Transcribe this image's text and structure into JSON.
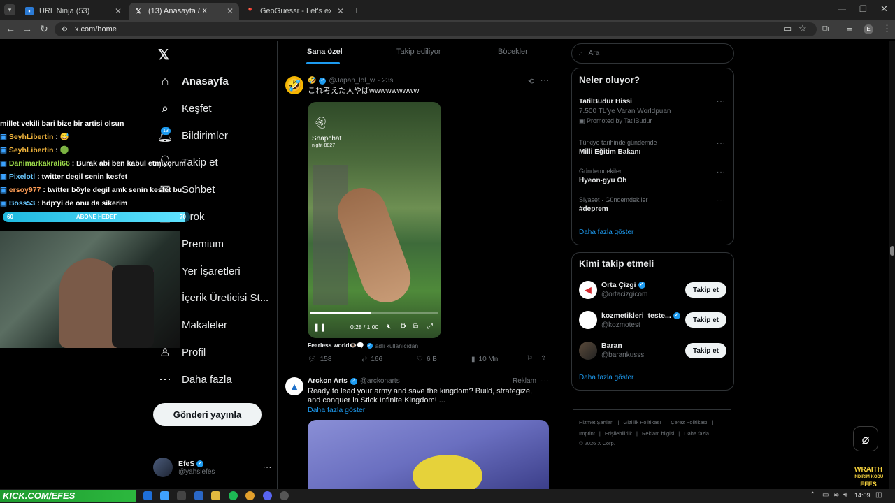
{
  "browser": {
    "tabs": [
      {
        "title": "URL Ninja (53)"
      },
      {
        "title": "(13) Anasayfa / X"
      },
      {
        "title": "GeoGuessr - Let's explore the w"
      }
    ],
    "url": "x.com/home",
    "profile_initial": "E"
  },
  "sidebar": {
    "logo": "𝕏",
    "notif_badge": "13",
    "items": [
      {
        "label": "Anasayfa",
        "icon": "home-icon"
      },
      {
        "label": "Keşfet",
        "icon": "search-icon"
      },
      {
        "label": "Bildirimler",
        "icon": "bell-icon"
      },
      {
        "label": "Takip et",
        "icon": "follow-icon"
      },
      {
        "label": "Sohbet",
        "icon": "chat-icon"
      },
      {
        "label": "Grok",
        "icon": "grok-icon"
      },
      {
        "label": "Premium",
        "icon": "x-premium-icon"
      },
      {
        "label": "Yer İşaretleri",
        "icon": "bookmark-icon"
      },
      {
        "label": "İçerik Üreticisi St...",
        "icon": "creator-studio-icon"
      },
      {
        "label": "Makaleler",
        "icon": "articles-icon"
      },
      {
        "label": "Profil",
        "icon": "profile-icon"
      },
      {
        "label": "Daha fazla",
        "icon": "more-icon"
      }
    ],
    "post_button": "Gönderi yayınla",
    "account": {
      "name": "EfeS",
      "handle": "@yahslefes"
    }
  },
  "overlay": {
    "chat": [
      {
        "user": "",
        "color": "#ffffff",
        "msg": "millet vekili bari bize bir artisi olsun"
      },
      {
        "user": "SeyhLibertin",
        "color": "#f6b83d",
        "msg": ": 😅"
      },
      {
        "user": "SeyhLibertin",
        "color": "#f6b83d",
        "msg": ": 🟢"
      },
      {
        "user": "Danimarkakrali66",
        "color": "#9bd94a",
        "msg": ": Burak abi ben kabul etmiyorum"
      },
      {
        "user": "Pixelotl",
        "color": "#6ac8ff",
        "msg": ": twitter degil senin kesfet"
      },
      {
        "user": "ersoy977",
        "color": "#ff9d55",
        "msg": ": twitter böyle degil amk senin kesfet bu"
      },
      {
        "user": "Boss53",
        "color": "#6ac8ff",
        "msg": ": hdp'yi de onu da sikerim"
      }
    ],
    "goal": {
      "left": "60",
      "label": "ABONE HEDEF",
      "right": "70",
      "progress": 0.97
    },
    "banner": "KICK.COM/EFES",
    "wraith_line1": "WRAITH",
    "wraith_line2": "INDIRIM KODU",
    "wraith_line3": "EFES"
  },
  "feed": {
    "tabs": [
      "Sana özel",
      "Takip ediliyor",
      "Böcekler"
    ],
    "tweet1": {
      "emoji": "🤣",
      "handle": "@Japan_lol_w",
      "time": "· 23s",
      "text": "これ考えた人やばwwwwwwwww",
      "video_watermark": "Snapchat",
      "video_sub": "night-8827",
      "video_time": "0:28 / 1:00",
      "progress": 0.47,
      "source_name": "Fearless world👁️🗨️",
      "source_suffix": "adlı kullanıcıdan",
      "replies": "158",
      "reposts": "166",
      "likes": "6 B",
      "views": "10 Mn"
    },
    "tweet2": {
      "name": "Arckon Arts",
      "handle": "@arckonarts",
      "tag": "Reklam",
      "text": "Ready to lead your army and save the kingdom?  Build, strategize, and conquer in Stick Infinite Kingdom! ...",
      "more": "Daha fazla göster"
    }
  },
  "right": {
    "search_placeholder": "Ara",
    "trends_title": "Neler oluyor?",
    "promo": {
      "title": "TatilBudur Hissi",
      "sub": "7.500 TL'ye Varan Worldpuan",
      "promoted": "Promoted by TatilBudur"
    },
    "trends": [
      {
        "meta": "Türkiye tarihinde gündemde",
        "title": "Milli Eğitim Bakanı"
      },
      {
        "meta": "Gündemdekiler",
        "title": "Hyeon-gyu Oh"
      },
      {
        "meta": "Siyaset · Gündemdekiler",
        "title": "#deprem"
      }
    ],
    "show_more": "Daha fazla göster",
    "who_title": "Kimi takip etmeli",
    "who": [
      {
        "name": "Orta Çizgi",
        "handle": "@ortacizgicom",
        "verified": true
      },
      {
        "name": "kozmetikleri_teste...",
        "handle": "@kozmotest",
        "verified": true
      },
      {
        "name": "Baran",
        "handle": "@barankusss",
        "verified": false
      }
    ],
    "follow_label": "Takip et",
    "who_more": "Daha fazla göster",
    "footer": [
      "Hizmet Şartları",
      "|",
      "Gizlilik Politikası",
      "|",
      "Çerez Politikası",
      "|",
      "Imprint",
      "|",
      "Erişilebilirlik",
      "|",
      "Reklam bilgisi",
      "|",
      "Daha fazla ..."
    ],
    "copyright": "© 2026 X Corp."
  },
  "taskbar": {
    "time": "14:09"
  }
}
